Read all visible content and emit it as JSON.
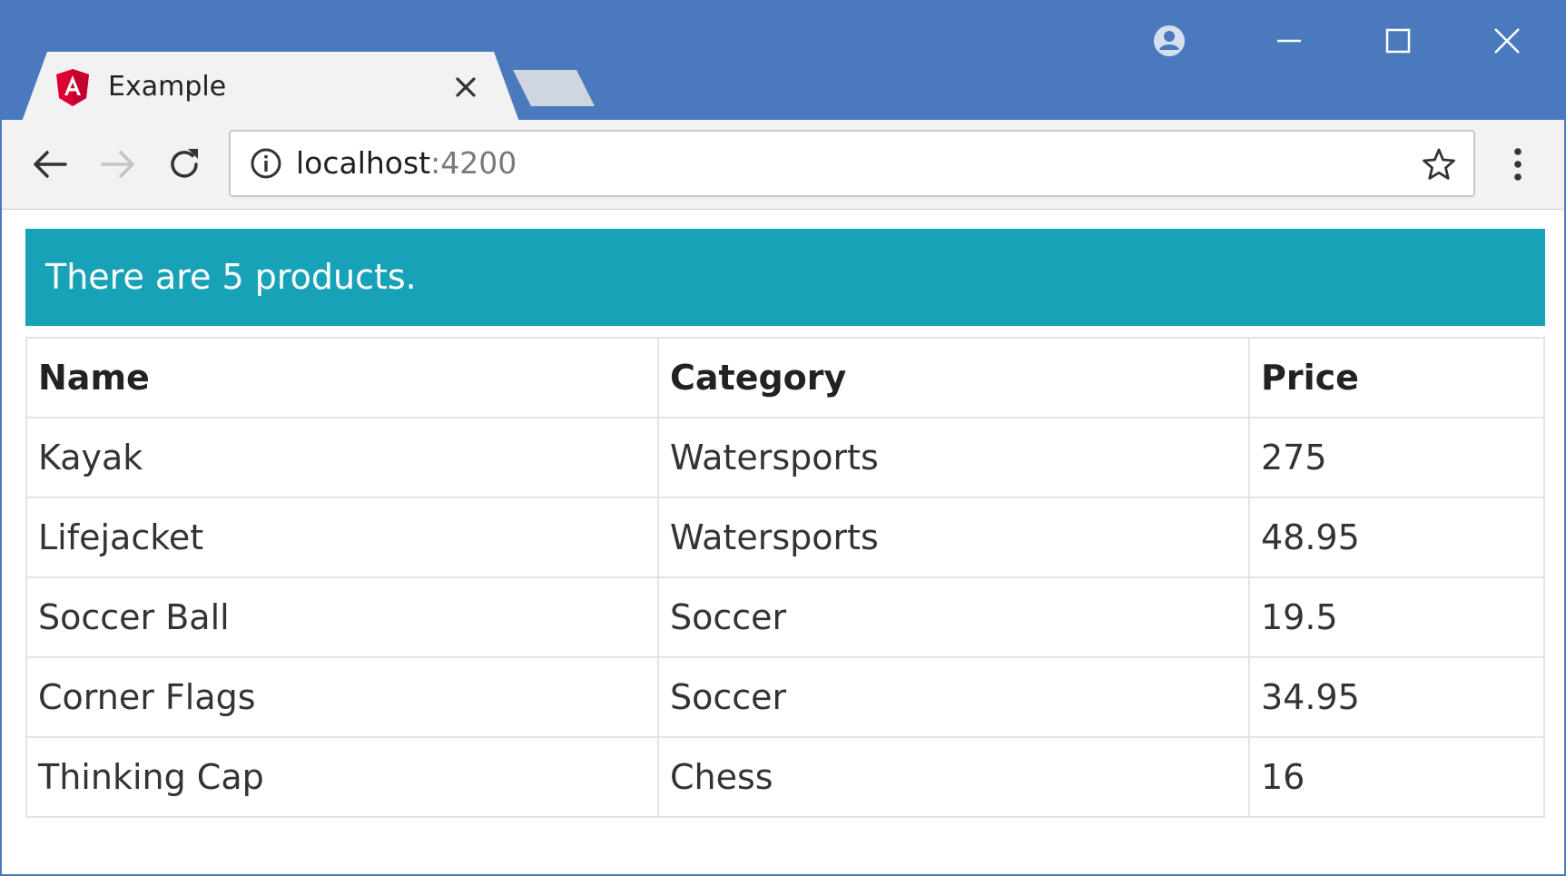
{
  "browser": {
    "tab": {
      "title": "Example",
      "favicon": "angular-logo-icon"
    },
    "address_bar": {
      "host": "localhost",
      "port": ":4200"
    },
    "window_controls": [
      "minimize-icon",
      "maximize-icon",
      "close-icon"
    ]
  },
  "page": {
    "banner": "There are 5 products.",
    "table": {
      "headers": [
        "Name",
        "Category",
        "Price"
      ],
      "rows": [
        [
          "Kayak",
          "Watersports",
          "275"
        ],
        [
          "Lifejacket",
          "Watersports",
          "48.95"
        ],
        [
          "Soccer Ball",
          "Soccer",
          "19.5"
        ],
        [
          "Corner Flags",
          "Soccer",
          "34.95"
        ],
        [
          "Thinking Cap",
          "Chess",
          "16"
        ]
      ]
    }
  },
  "colors": {
    "titlebar": "#4a7abd",
    "banner_bg": "#17a2b8",
    "banner_text": "#ffffff",
    "angular_red": "#dd0031"
  }
}
